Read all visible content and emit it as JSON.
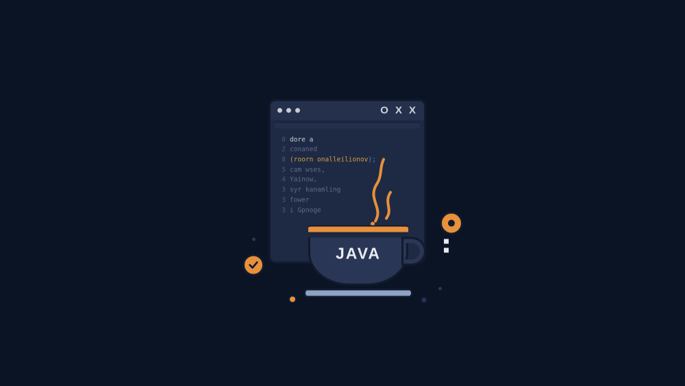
{
  "window": {
    "controls": {
      "min": "O",
      "close": "X",
      "max": "X"
    }
  },
  "code": {
    "lines": [
      {
        "n": "0",
        "t": "dore a"
      },
      {
        "n": "2",
        "t": "conaned"
      },
      {
        "n": "8",
        "t_pre": "(",
        "t_kw": "roorn onalleilionov",
        "t_post": ");"
      },
      {
        "n": "5",
        "t": "cam wses,"
      },
      {
        "n": "4",
        "t": "Yainow,"
      },
      {
        "n": "3",
        "t": "syr kanamling"
      },
      {
        "n": "3",
        "t": "fower"
      },
      {
        "n": "3",
        "t": "i Gpnoge"
      }
    ]
  },
  "cup": {
    "label": "JAVA"
  }
}
